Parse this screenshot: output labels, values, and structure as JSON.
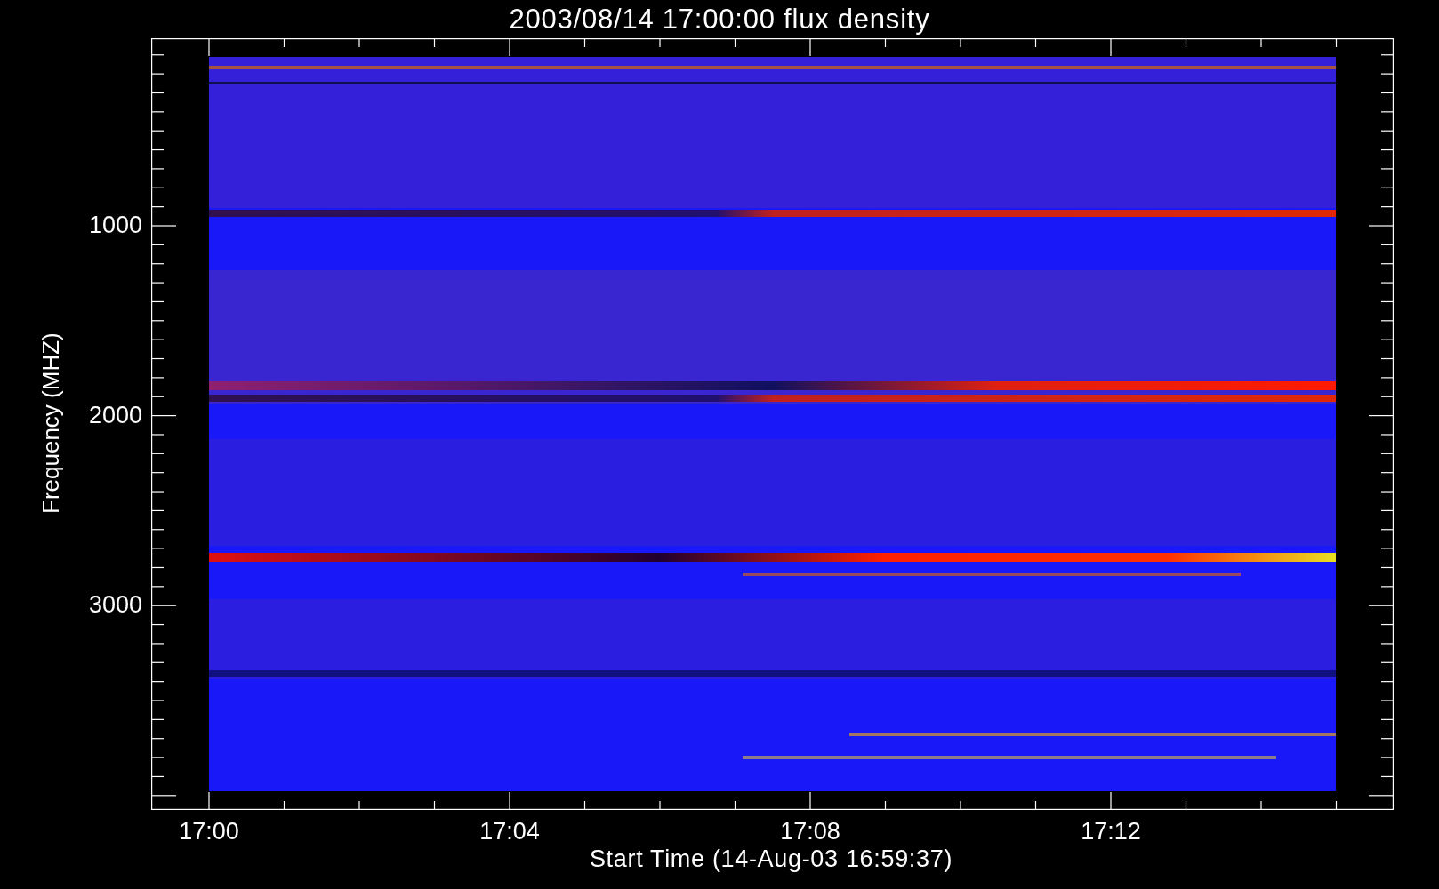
{
  "title": "2003/08/14 17:00:00 flux density",
  "y_axis": {
    "label": "Frequency (MHZ)",
    "ticks": [
      "1000",
      "2000",
      "3000"
    ]
  },
  "x_axis": {
    "label": "Start Time (14-Aug-03 16:59:37)",
    "ticks": [
      "17:00",
      "17:04",
      "17:08",
      "17:12"
    ]
  }
}
